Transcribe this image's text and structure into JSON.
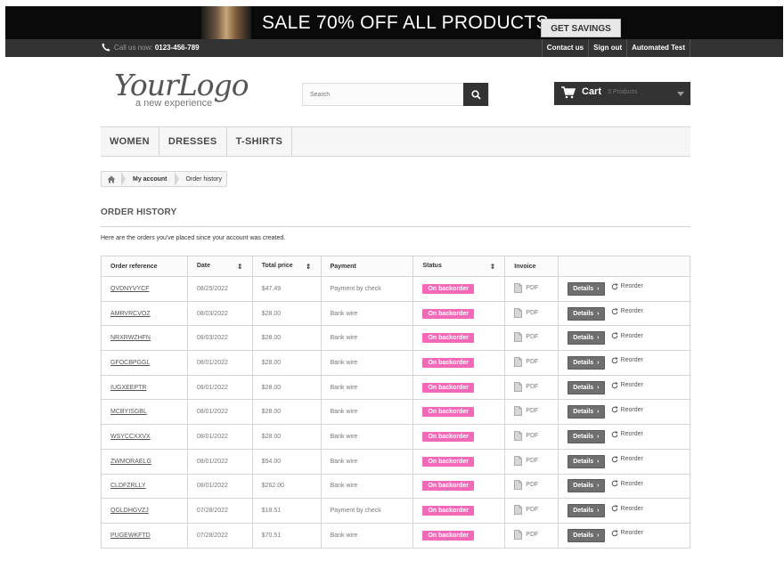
{
  "banner": {
    "headline": "SALE 70% OFF ALL PRODUCTS",
    "cta": "GET SAVINGS NOW"
  },
  "topnav": {
    "phone_label": "Call us now:",
    "phone_number": "0123-456-789",
    "links": [
      "Contact us",
      "Sign out",
      "Automated Test"
    ]
  },
  "header": {
    "logo_main": "YourLogo",
    "logo_tagline": "a new experience",
    "search_placeholder": "Search",
    "cart_label": "Cart",
    "cart_count": "3 Products"
  },
  "menu": [
    "WOMEN",
    "DRESSES",
    "T-SHIRTS"
  ],
  "breadcrumb": {
    "parent": "My account",
    "current": "Order history"
  },
  "page": {
    "title": "ORDER HISTORY",
    "intro": "Here are the orders you've placed since your account was created."
  },
  "table": {
    "columns": [
      "Order reference",
      "Date",
      "Total price",
      "Payment",
      "Status",
      "Invoice",
      ""
    ],
    "details_label": "Details",
    "reorder_label": "Reorder",
    "invoice_label": "PDF",
    "rows": [
      {
        "ref": "QVDNYVYCF",
        "date": "08/25/2022",
        "total": "$47.49",
        "payment": "Payment by check",
        "status": "On backorder"
      },
      {
        "ref": "AMRVRCVOZ",
        "date": "08/03/2022",
        "total": "$28.00",
        "payment": "Bank wire",
        "status": "On backorder"
      },
      {
        "ref": "NRXRWZHFN",
        "date": "08/03/2022",
        "total": "$28.00",
        "payment": "Bank wire",
        "status": "On backorder"
      },
      {
        "ref": "GFOCBPGGL",
        "date": "08/01/2022",
        "total": "$28.00",
        "payment": "Bank wire",
        "status": "On backorder"
      },
      {
        "ref": "IUGXEEPTR",
        "date": "08/01/2022",
        "total": "$28.00",
        "payment": "Bank wire",
        "status": "On backorder"
      },
      {
        "ref": "MCBYISGBL",
        "date": "08/01/2022",
        "total": "$28.00",
        "payment": "Bank wire",
        "status": "On backorder"
      },
      {
        "ref": "WSYCCXXVX",
        "date": "08/01/2022",
        "total": "$28.00",
        "payment": "Bank wire",
        "status": "On backorder"
      },
      {
        "ref": "ZWMORAELG",
        "date": "08/01/2022",
        "total": "$54.00",
        "payment": "Bank wire",
        "status": "On backorder"
      },
      {
        "ref": "CLDFZRLLY",
        "date": "08/01/2022",
        "total": "$262.00",
        "payment": "Bank wire",
        "status": "On backorder"
      },
      {
        "ref": "QGLDHGVZJ",
        "date": "07/28/2022",
        "total": "$18.51",
        "payment": "Payment by check",
        "status": "On backorder"
      },
      {
        "ref": "PUGEWKFTD",
        "date": "07/28/2022",
        "total": "$70.51",
        "payment": "Bank wire",
        "status": "On backorder"
      }
    ]
  },
  "colors": {
    "status_badge": "#f468b8",
    "dark_bar": "#333333",
    "banner_bg": "#0a0a0a"
  },
  "icons": [
    "phone-icon",
    "search-icon",
    "cart-icon",
    "home-icon",
    "sort-icon",
    "pdf-file-icon",
    "chevron-right-icon",
    "refresh-icon"
  ]
}
